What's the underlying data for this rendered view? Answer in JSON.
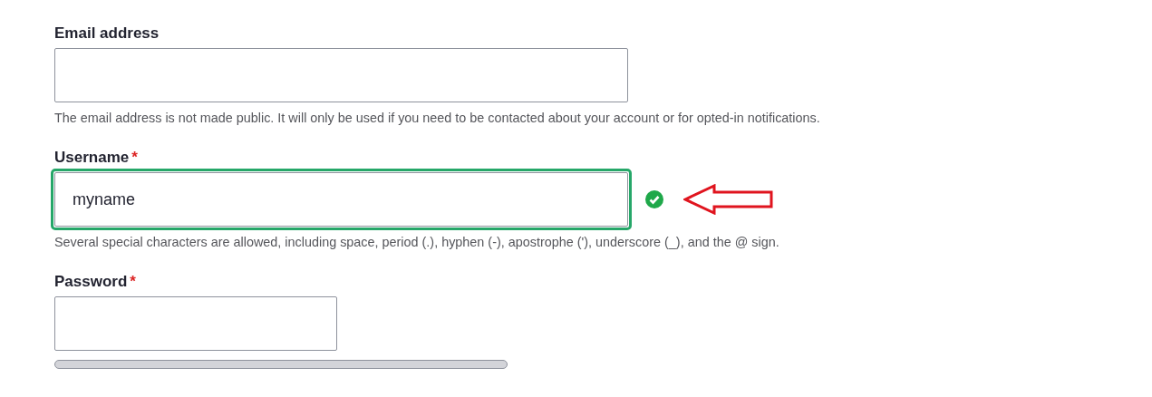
{
  "fields": [
    {
      "label": "Email address",
      "kind": "email",
      "focused": false,
      "valid": false,
      "description": "The email address is not made public. It will only be used if you need to be contacted about your account or for opted-in notifications."
    },
    {
      "label": "Username",
      "kind": "text",
      "required_mark": "*",
      "focused": true,
      "valid": true,
      "value": "myname",
      "description": "Several special characters are allowed, including space, period (.), hyphen (-), apostrophe ('), underscore (_), and the @ sign."
    },
    {
      "label": "Password",
      "kind": "password",
      "required_mark": "*",
      "focused": false,
      "valid": false,
      "strength_meter": true
    }
  ]
}
